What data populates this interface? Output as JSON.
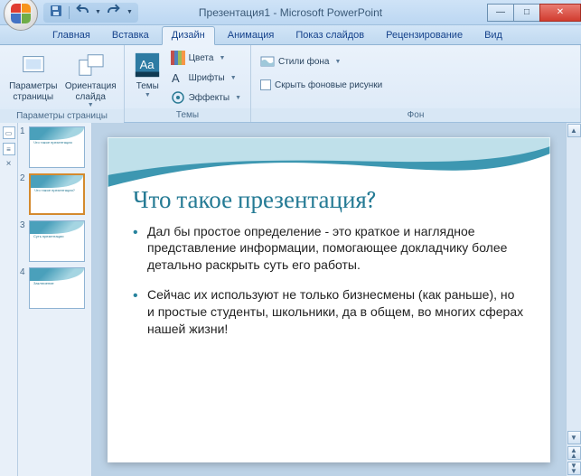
{
  "window": {
    "title": "Презентация1 - Microsoft PowerPoint"
  },
  "tabs": {
    "items": [
      {
        "label": "Главная"
      },
      {
        "label": "Вставка"
      },
      {
        "label": "Дизайн"
      },
      {
        "label": "Анимация"
      },
      {
        "label": "Показ слайдов"
      },
      {
        "label": "Рецензирование"
      },
      {
        "label": "Вид"
      }
    ],
    "active_index": 2
  },
  "ribbon": {
    "page_setup": {
      "label": "Параметры страницы",
      "page_params": "Параметры страницы",
      "orientation": "Ориентация слайда"
    },
    "themes": {
      "label": "Темы",
      "themes_btn": "Темы",
      "colors": "Цвета",
      "fonts": "Шрифты",
      "effects": "Эффекты"
    },
    "background": {
      "label": "Фон",
      "styles": "Стили фона",
      "hide_graphics": "Скрыть фоновые рисунки"
    }
  },
  "thumbnails": [
    {
      "num": "1",
      "preview": "Что такое презентация"
    },
    {
      "num": "2",
      "preview": "Что такое презентация?"
    },
    {
      "num": "3",
      "preview": "Суть презентации"
    },
    {
      "num": "4",
      "preview": "Заключение"
    }
  ],
  "selected_thumb": 1,
  "slide": {
    "title": "Что такое презентация?",
    "bullets": [
      "Дал бы простое определение - это краткое и наглядное представление информации, помогающее докладчику более детально раскрыть суть его работы.",
      "Сейчас их используют не только бизнесмены (как раньше), но и простые студенты, школьники, да в общем, во многих сферах нашей жизни!"
    ]
  }
}
